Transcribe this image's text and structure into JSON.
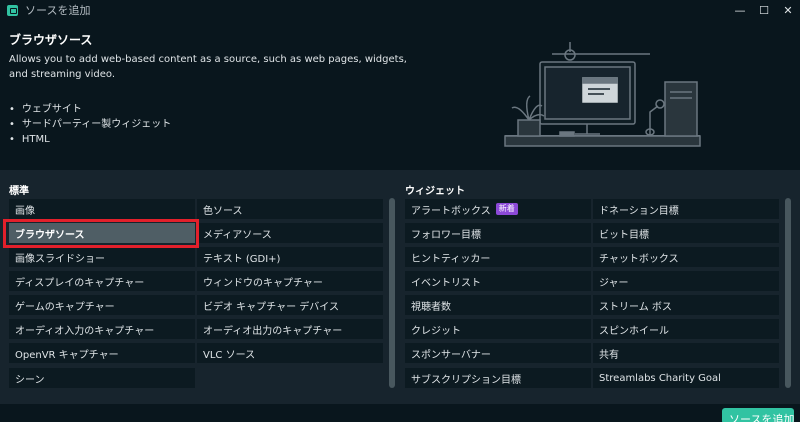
{
  "window": {
    "title": "ソースを追加",
    "minimize": "—",
    "maximize": "☐",
    "close": "✕"
  },
  "source": {
    "title": "ブラウザソース",
    "description": "Allows you to add web-based content as a source, such as web pages, widgets, and streaming video.",
    "features": [
      "ウェブサイト",
      "サードパーティー製ウィジェット",
      "HTML"
    ]
  },
  "standard": {
    "label": "標準",
    "col1": [
      "画像",
      "ブラウザソース",
      "画像スライドショー",
      "ディスプレイのキャプチャー",
      "ゲームのキャプチャー",
      "オーディオ入力のキャプチャー",
      "OpenVR キャプチャー",
      "シーン"
    ],
    "col2": [
      "色ソース",
      "メディアソース",
      "テキスト (GDI+)",
      "ウィンドウのキャプチャー",
      "ビデオ キャプチャー デバイス",
      "オーディオ出力のキャプチャー",
      "VLC ソース"
    ]
  },
  "widgets": {
    "label": "ウィジェット",
    "col1": [
      "アラートボックス",
      "フォロワー目標",
      "ヒントティッカー",
      "イベントリスト",
      "視聴者数",
      "クレジット",
      "スポンサーバナー",
      "サブスクリプション目標"
    ],
    "col2": [
      "ドネーション目標",
      "ビット目標",
      "チャットボックス",
      "ジャー",
      "ストリーム ボス",
      "スピンホイール",
      "共有",
      "Streamlabs Charity Goal"
    ],
    "new_badge": "新着"
  },
  "footer": {
    "add_button": "ソースを追加"
  },
  "colors": {
    "accent": "#31c3a2",
    "highlight": "#e3202b",
    "badge": "#8c49d8"
  }
}
